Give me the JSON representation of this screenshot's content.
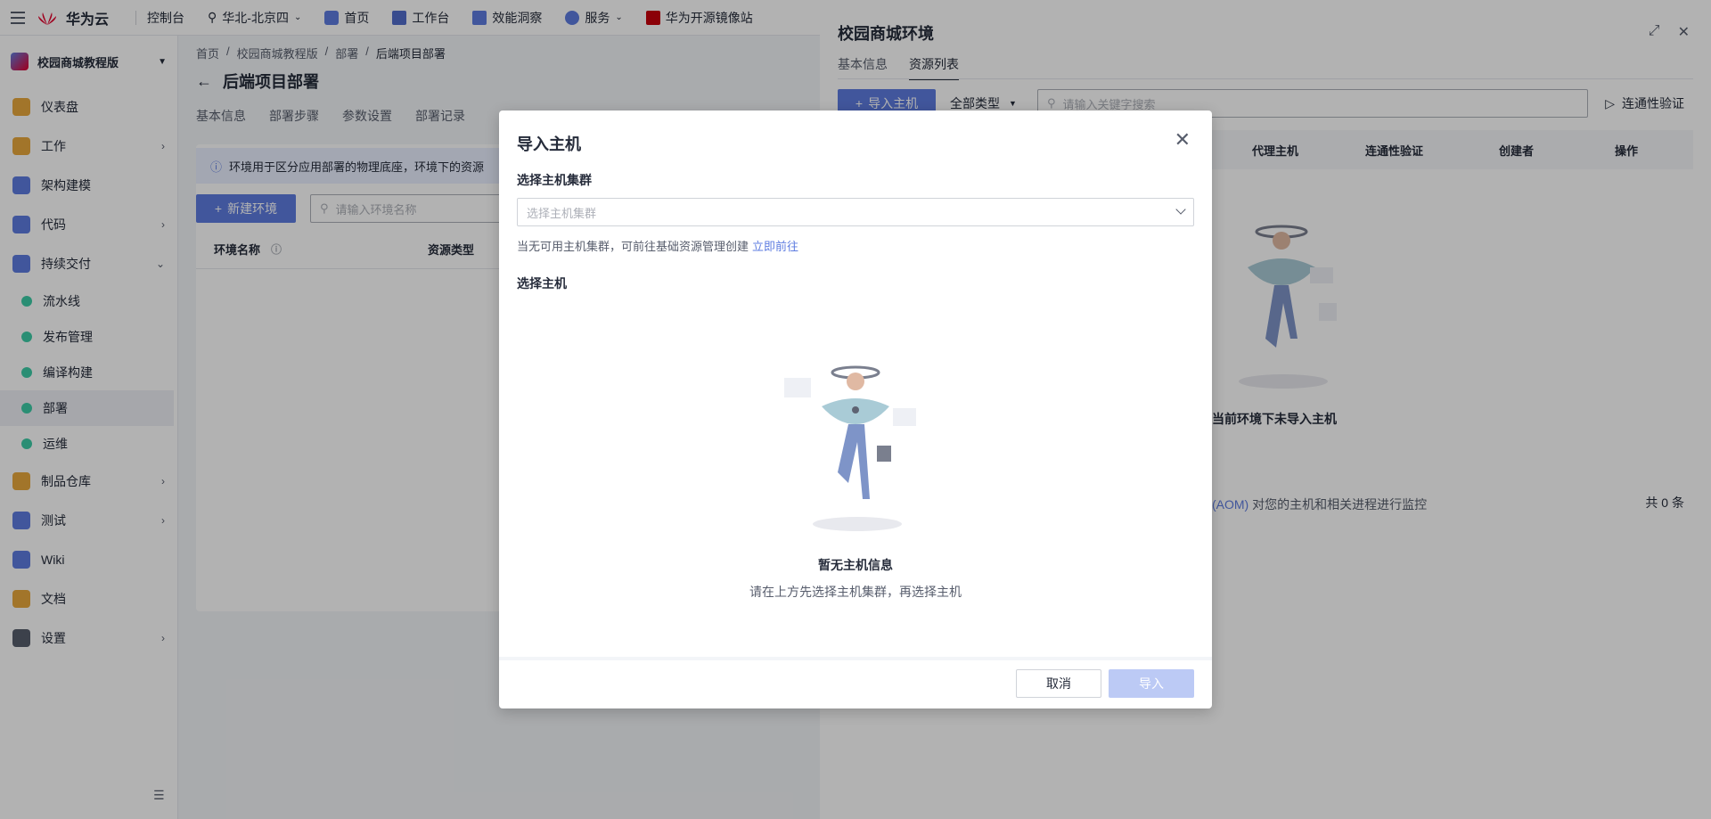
{
  "topbar": {
    "logo_text": "华为云",
    "console": "控制台",
    "region": "华北-北京四",
    "nav": [
      "首页",
      "工作台",
      "效能洞察",
      "服务",
      "华为开源镜像站"
    ]
  },
  "sidebar": {
    "project": "校园商城教程版",
    "items": [
      {
        "label": "仪表盘",
        "chevron": false,
        "sub": false,
        "active": false
      },
      {
        "label": "工作",
        "chevron": true,
        "sub": false,
        "active": false
      },
      {
        "label": "架构建模",
        "chevron": false,
        "sub": false,
        "active": false
      },
      {
        "label": "代码",
        "chevron": true,
        "sub": false,
        "active": false
      },
      {
        "label": "持续交付",
        "chevron": true,
        "sub": false,
        "active": false
      },
      {
        "label": "流水线",
        "chevron": false,
        "sub": true,
        "active": false
      },
      {
        "label": "发布管理",
        "chevron": false,
        "sub": true,
        "active": false
      },
      {
        "label": "编译构建",
        "chevron": false,
        "sub": true,
        "active": false
      },
      {
        "label": "部署",
        "chevron": false,
        "sub": true,
        "active": true
      },
      {
        "label": "运维",
        "chevron": false,
        "sub": true,
        "active": false
      },
      {
        "label": "制品仓库",
        "chevron": true,
        "sub": false,
        "active": false
      },
      {
        "label": "测试",
        "chevron": true,
        "sub": false,
        "active": false
      },
      {
        "label": "Wiki",
        "chevron": false,
        "sub": false,
        "active": false
      },
      {
        "label": "文档",
        "chevron": false,
        "sub": false,
        "active": false
      },
      {
        "label": "设置",
        "chevron": true,
        "sub": false,
        "active": false
      }
    ]
  },
  "main": {
    "breadcrumb": [
      "首页",
      "校园商城教程版",
      "部署",
      "后端项目部署"
    ],
    "title": "后端项目部署",
    "tabs": [
      "基本信息",
      "部署步骤",
      "参数设置",
      "部署记录"
    ],
    "info": "环境用于区分应用部署的物理底座，环境下的资源",
    "new_env": "新建环境",
    "search_placeholder": "请输入环境名称",
    "columns": [
      "环境名称",
      "资源类型"
    ]
  },
  "drawer": {
    "title": "校园商城环境",
    "tabs": [
      "基本信息",
      "资源列表"
    ],
    "import_btn": "导入主机",
    "type_filter": "全部类型",
    "search_placeholder": "请输入关键字搜索",
    "verify": "连通性验证",
    "columns": [
      "代理主机",
      "连通性验证",
      "创建者",
      "操作"
    ],
    "empty_title": "当前环境下未导入主机",
    "note_prefix": "(AOM)",
    "note_suffix": "对您的主机和相关进程进行监控",
    "count": "共 0 条"
  },
  "modal": {
    "title": "导入主机",
    "cluster_label": "选择主机集群",
    "cluster_placeholder": "选择主机集群",
    "hint": "当无可用主机集群，可前往基础资源管理创建",
    "hint_link": "立即前往",
    "host_label": "选择主机",
    "empty_title": "暂无主机信息",
    "empty_desc": "请在上方先选择主机集群，再选择主机",
    "cancel": "取消",
    "import": "导入"
  }
}
